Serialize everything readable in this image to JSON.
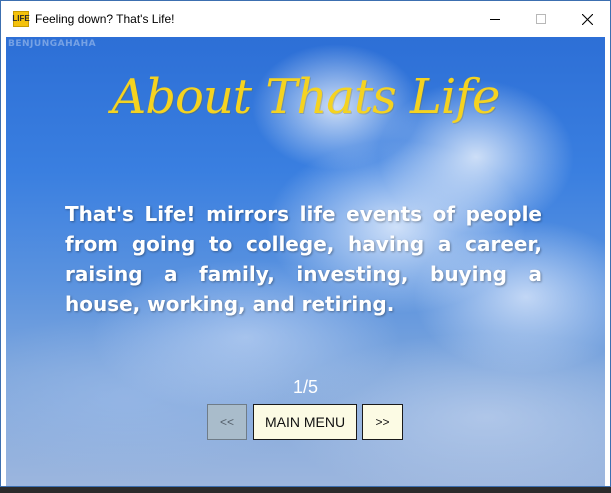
{
  "window": {
    "title": "Feeling down? That's Life!",
    "app_icon_text": "LIFE"
  },
  "screen": {
    "watermark": "BENJUNGAHAHA",
    "heading": "About Thats Life",
    "body": "That's Life! mirrors life events of people from going to college, having a career, raising a family, investing, buying a house, working, and retiring.",
    "page_indicator": "1/5"
  },
  "nav": {
    "prev_label": "<<",
    "menu_label": "MAIN MENU",
    "next_label": ">>"
  },
  "colors": {
    "heading": "#f5d320",
    "button_bg": "#fcfbe4",
    "button_disabled_bg": "#a9bccb"
  }
}
